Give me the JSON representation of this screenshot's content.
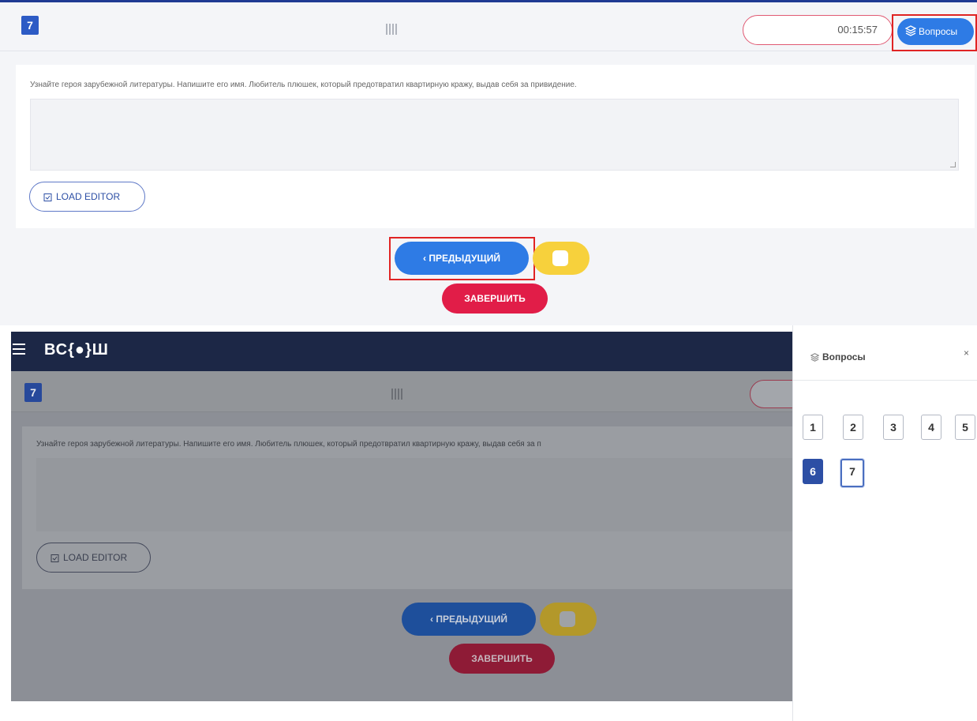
{
  "top": {
    "question_number": "7",
    "timer": "00:15:57",
    "questions_button": "Вопросы",
    "question_text": "Узнайте героя зарубежной литературы. Напишите его имя. Любитель плюшек, который предотвратил квартирную кражу, выдав себя за привидение.",
    "load_editor": "LOAD EDITOR",
    "prev_button": "‹ ПРЕДЫДУЩИЙ",
    "finish_button": "ЗАВЕРШИТЬ"
  },
  "bottom": {
    "brand": "ВС{●}Ш",
    "question_number": "7",
    "question_text": "Узнайте героя зарубежной литературы. Напишите его имя. Любитель плюшек, который предотвратил квартирную кражу, выдав себя за п",
    "load_editor": "LOAD EDITOR",
    "prev_button": "‹ ПРЕДЫДУЩИЙ",
    "finish_button": "ЗАВЕРШИТЬ",
    "panel": {
      "title": "Вопросы",
      "close": "×",
      "questions": [
        {
          "label": "1",
          "state": "default"
        },
        {
          "label": "2",
          "state": "default"
        },
        {
          "label": "3",
          "state": "default"
        },
        {
          "label": "4",
          "state": "default"
        },
        {
          "label": "5",
          "state": "default"
        },
        {
          "label": "6",
          "state": "answered"
        },
        {
          "label": "7",
          "state": "current"
        }
      ]
    }
  },
  "colors": {
    "primary_blue": "#2e7be5",
    "dark_navy": "#1c2746",
    "finish_red": "#e11d48",
    "yellow": "#f7d13c",
    "highlight_red": "#e02424"
  }
}
